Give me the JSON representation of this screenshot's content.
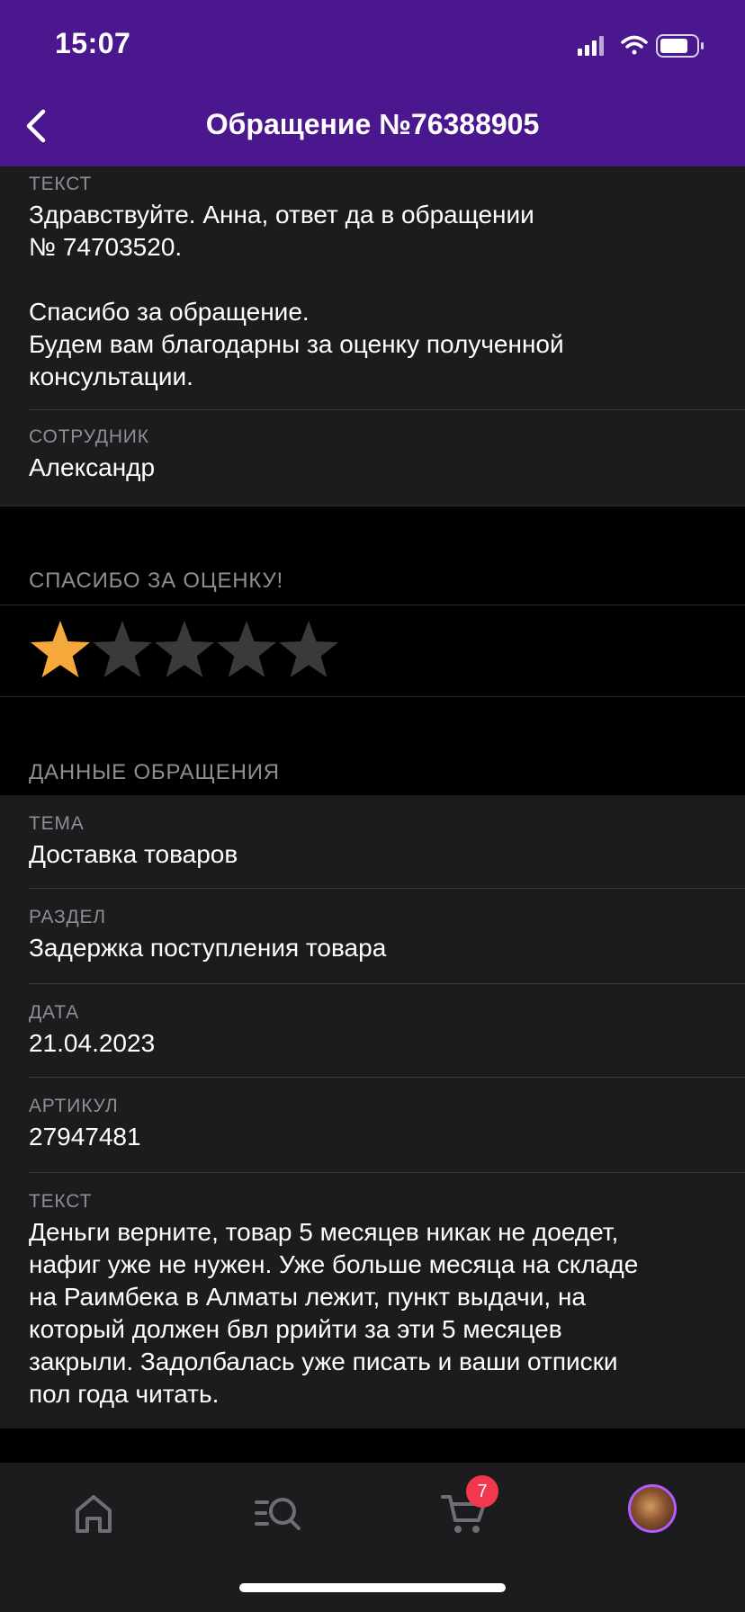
{
  "status_bar": {
    "time": "15:07"
  },
  "header": {
    "title": "Обращение №76388905",
    "back_icon": "chevron-left-icon"
  },
  "response": {
    "text_label": "ТЕКСТ",
    "text_value": "Здравствуйте. Анна, ответ да в обращении\n№ 74703520.\n\nСпасибо за обращение.\nБудем вам благодарны за оценку полученной\nконсультации.",
    "employee_label": "СОТРУДНИК",
    "employee_value": "Александр"
  },
  "rating": {
    "title": "СПАСИБО ЗА ОЦЕНКУ!",
    "value": 1,
    "max": 5,
    "active_color": "#f4a93a",
    "inactive_color": "#3a3a3c"
  },
  "details": {
    "title": "ДАННЫЕ ОБРАЩЕНИЯ",
    "fields": [
      {
        "label": "ТЕМА",
        "value": "Доставка товаров"
      },
      {
        "label": "РАЗДЕЛ",
        "value": "Задержка поступления товара"
      },
      {
        "label": "ДАТА",
        "value": "21.04.2023"
      },
      {
        "label": "АРТИКУЛ",
        "value": "27947481"
      },
      {
        "label": "ТЕКСТ",
        "value": "Деньги верните, товар 5 месяцев никак не доедет,\nнафиг уже не нужен. Уже больше месяца на складе\nна Раимбека в Алматы лежит, пункт выдачи, на\nкоторый должен бвл ррийти за эти 5 месяцев\nзакрыли. Задолбалась уже писать и ваши отписки\nпол года читать."
      }
    ]
  },
  "tabbar": {
    "tabs": [
      {
        "icon": "home-icon"
      },
      {
        "icon": "catalog-search-icon"
      },
      {
        "icon": "cart-icon",
        "badge": "7"
      },
      {
        "icon": "profile-avatar"
      }
    ]
  },
  "colors": {
    "header_bg": "#4a178f",
    "accent": "#b45bff",
    "badge": "#f2374f"
  }
}
